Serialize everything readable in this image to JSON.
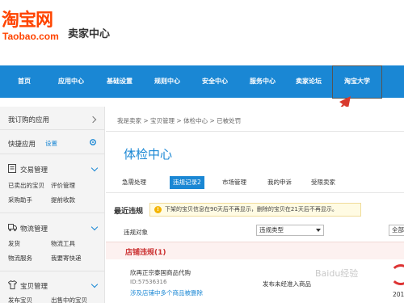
{
  "header": {
    "logo_cn": "淘宝网",
    "logo_en": "Taobao.com",
    "center_title": "卖家中心"
  },
  "nav": {
    "items": [
      "首页",
      "应用中心",
      "基础设置",
      "规则中心",
      "安全中心",
      "服务中心",
      "卖家论坛",
      "淘宝大学"
    ]
  },
  "sidebar": {
    "my_apps": "我订购的应用",
    "quick_apps": "快捷应用",
    "settings_link": "设置",
    "sections": [
      {
        "title": "交易管理",
        "links": [
          "已卖出的宝贝",
          "评价管理",
          "采购助手",
          "提前收款"
        ]
      },
      {
        "title": "物流管理",
        "links": [
          "发货",
          "物流工具",
          "物流服务",
          "我要寄快递"
        ]
      },
      {
        "title": "宝贝管理",
        "links": [
          "发布宝贝",
          "出售中的宝贝"
        ]
      }
    ]
  },
  "main": {
    "breadcrumb": "我是卖家 > 宝贝管理 > 体检中心 > 已被处罚",
    "page_title": "体检中心",
    "tabs": [
      "急需处理",
      "违规记录2",
      "市场管理",
      "我的申诉",
      "受限卖家"
    ],
    "recent_title": "最近违规",
    "notice": "下架的宝贝信息在90天后不再显示，删除的宝贝在21天后不再显示。",
    "filter_label": "违规对象",
    "select_type": "违规类型",
    "select_all": "全部",
    "section_title": "店铺违规(1)",
    "item": {
      "title": "欣再正宗泰国商品代购",
      "id": "ID:57536316",
      "link": "涉及店铺中多个商品被删除",
      "status": "发布未经准入商品",
      "year": "201"
    }
  },
  "watermark": "Baidu经验"
}
